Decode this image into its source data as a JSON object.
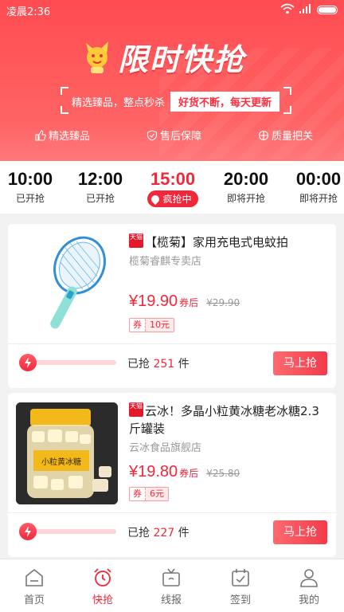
{
  "status_bar": {
    "time": "凌晨2:36"
  },
  "banner": {
    "title": "限时快抢",
    "slogan_left": "精选臻品，整点秒杀",
    "slogan_right": "好货不断，每天更新",
    "features": [
      "精选臻品",
      "售后保障",
      "质量把关"
    ]
  },
  "time_tabs": [
    {
      "time": "10:00",
      "status": "已开抢"
    },
    {
      "time": "12:00",
      "status": "已开抢"
    },
    {
      "time": "15:00",
      "status": "疯抢中",
      "active": true
    },
    {
      "time": "20:00",
      "status": "即将开抢"
    },
    {
      "time": "00:00",
      "status": "即将开抢"
    }
  ],
  "products": [
    {
      "platform_badge": "天猫",
      "title": "【榄菊】家用充电式电蚊拍",
      "shop": "榄菊睿麒专卖店",
      "price": "¥19.90",
      "price_suffix": "券后",
      "original_price": "¥29.90",
      "coupon_label": "券",
      "coupon_amount": "10元",
      "sold_prefix": "已抢",
      "sold_count": "251",
      "sold_unit": "件",
      "buy_label": "马上抢"
    },
    {
      "platform_badge": "天猫",
      "title": "云冰！多晶小粒黄冰糖老冰糖2.3斤罐装",
      "shop": "云冰食品旗舰店",
      "price": "¥19.80",
      "price_suffix": "券后",
      "original_price": "¥25.80",
      "coupon_label": "券",
      "coupon_amount": "6元",
      "sold_prefix": "已抢",
      "sold_count": "227",
      "sold_unit": "件",
      "buy_label": "马上抢",
      "image_label": "小粒黄冰糖"
    }
  ],
  "bottom_nav": [
    {
      "label": "首页",
      "icon": "home-icon"
    },
    {
      "label": "快抢",
      "icon": "alarm-clock-icon",
      "active": true
    },
    {
      "label": "线报",
      "icon": "tv-icon"
    },
    {
      "label": "签到",
      "icon": "calendar-check-icon"
    },
    {
      "label": "我的",
      "icon": "user-icon"
    }
  ],
  "colors": {
    "accent": "#f2283a",
    "header": "#ff4b52"
  }
}
